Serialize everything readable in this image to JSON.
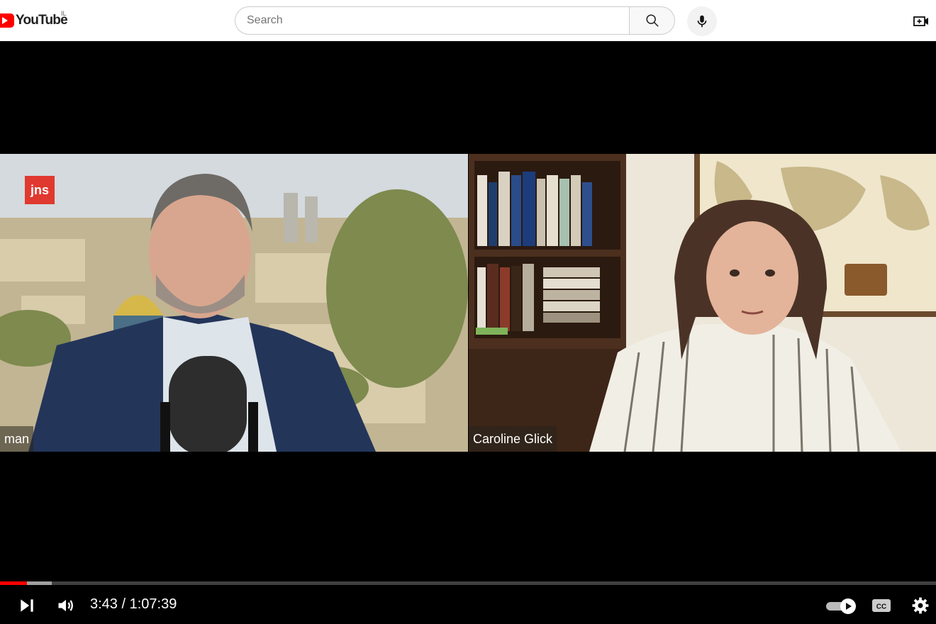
{
  "header": {
    "logo_text": "YouTube",
    "country_code": "IL",
    "search_placeholder": "Search",
    "search_value": "",
    "icons": {
      "search": "search-icon",
      "mic": "microphone-icon",
      "create": "video-add-icon"
    }
  },
  "video": {
    "left_participant": {
      "name_tag": "man",
      "logo_text": "jns"
    },
    "right_participant": {
      "name_tag": "Caroline Glick"
    }
  },
  "controls": {
    "current_time": "3:43",
    "separator": " / ",
    "duration": "1:07:39",
    "played_fraction": 0.055,
    "buffered_fraction": 0.029,
    "icons": [
      "next-icon",
      "volume-icon",
      "autoplay-toggle-icon",
      "captions-icon",
      "settings-icon"
    ]
  },
  "colors": {
    "accent": "#ff0000",
    "header_bg": "#ffffff",
    "player_bg": "#000000"
  }
}
